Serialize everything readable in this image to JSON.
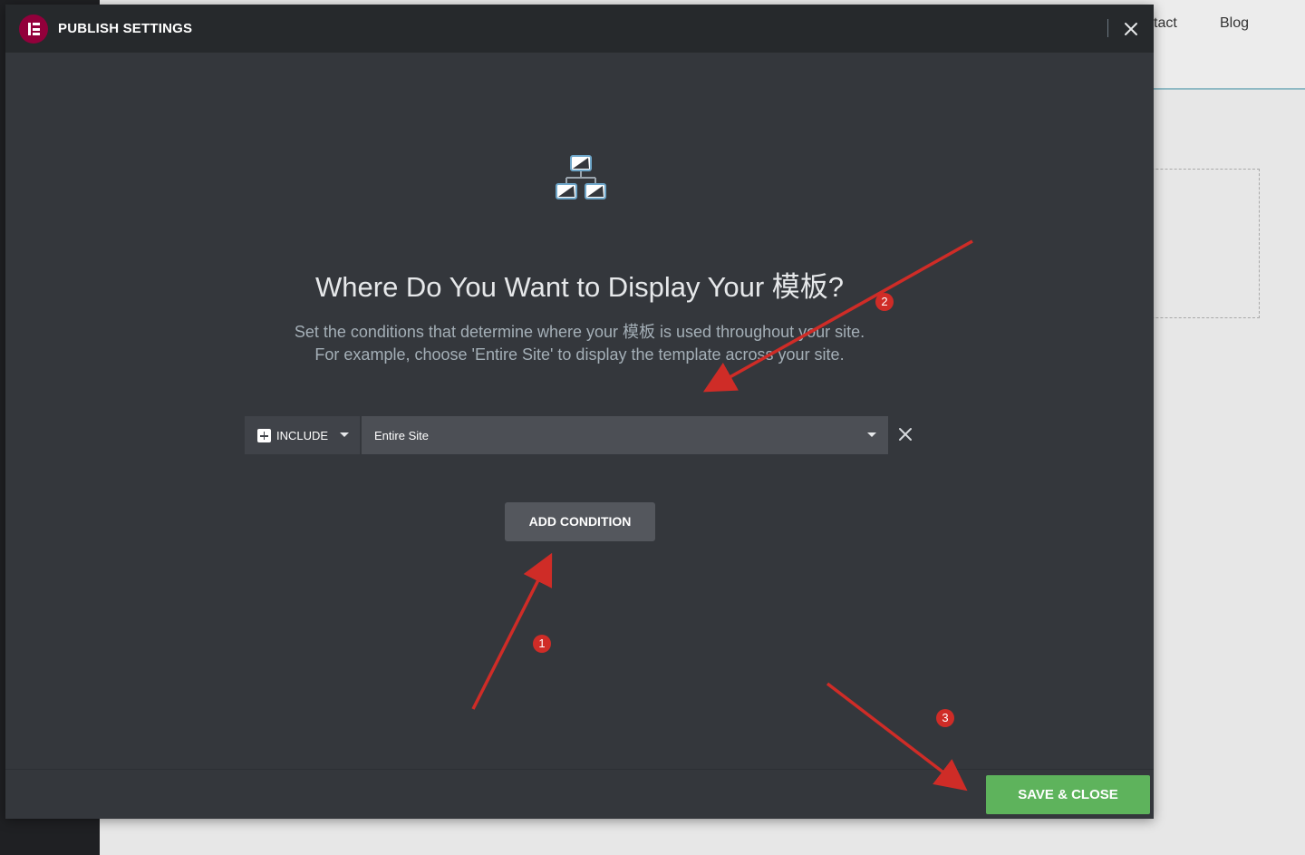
{
  "background": {
    "nav_items": [
      "tact",
      "Blog"
    ]
  },
  "modal": {
    "title": "PUBLISH SETTINGS",
    "heading": "Where Do You Want to Display Your 模板?",
    "description_line1": "Set the conditions that determine where your 模板 is used throughout your site.",
    "description_line2": "For example, choose 'Entire Site' to display the template across your site.",
    "condition": {
      "type_value": "INCLUDE",
      "target_value": "Entire Site"
    },
    "add_condition_label": "ADD CONDITION",
    "save_label": "SAVE & CLOSE"
  },
  "annotations": [
    "1",
    "2",
    "3"
  ],
  "colors": {
    "modal_bg": "#34373c",
    "header_bg": "#26292c",
    "logo": "#92003b",
    "save_green": "#5eb35c",
    "annotation_red": "#cf2c27"
  },
  "icons": {
    "logo": "elementor-logo-icon",
    "close": "close-icon",
    "sitemap": "sitemap-icon",
    "plus": "plus-square-icon",
    "caret": "caret-down-icon",
    "remove": "remove-x-icon"
  }
}
